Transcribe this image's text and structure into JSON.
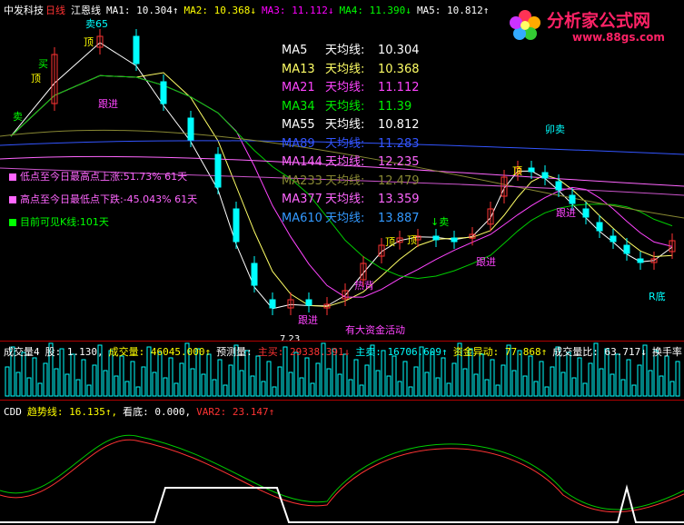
{
  "header": {
    "stock_name": "中发科技",
    "period": "日线",
    "indicator": "江恩线",
    "ma_values": [
      {
        "label": "MA1:",
        "value": "10.304",
        "arrow": "↑",
        "color": "#ffffff"
      },
      {
        "label": "MA2:",
        "value": "10.368",
        "arrow": "↓",
        "color": "#ffff00"
      },
      {
        "label": "MA3:",
        "value": "11.112",
        "arrow": "↓",
        "color": "#ff00ff"
      },
      {
        "label": "MA4:",
        "value": "11.390",
        "arrow": "↓",
        "color": "#00ff00"
      },
      {
        "label": "MA5:",
        "value": "10.812",
        "arrow": "↑",
        "color": "#ffffff"
      }
    ]
  },
  "logo": {
    "text": "分析家公式网",
    "url": "www.88gs.com"
  },
  "ma_table": [
    {
      "name": "MA5",
      "label": "天均线:",
      "value": "10.304",
      "color": "#ffffff"
    },
    {
      "name": "MA13",
      "label": "天均线:",
      "value": "10.368",
      "color": "#ffff66"
    },
    {
      "name": "MA21",
      "label": "天均线:",
      "value": "11.112",
      "color": "#ff44ff"
    },
    {
      "name": "MA34",
      "label": "天均线:",
      "value": "11.39",
      "color": "#00ee00"
    },
    {
      "name": "MA55",
      "label": "天均线:",
      "value": "10.812",
      "color": "#ffffff"
    },
    {
      "name": "MA89",
      "label": "天均线:",
      "value": "11.283",
      "color": "#3355ff"
    },
    {
      "name": "MA144",
      "label": "天均线:",
      "value": "12.235",
      "color": "#ff66ff"
    },
    {
      "name": "MA233",
      "label": "天均线:",
      "value": "12.479",
      "color": "#888833"
    },
    {
      "name": "MA377",
      "label": "天均线:",
      "value": "13.359",
      "color": "#ff66ff"
    },
    {
      "name": "MA610",
      "label": "天均线:",
      "value": "13.887",
      "color": "#3399ff"
    }
  ],
  "stats": [
    {
      "text": "低点至今日最高点上涨:51.73%  61天",
      "color": "#ff66ff"
    },
    {
      "text": "高点至今日最低点下跌:-45.043%  61天",
      "color": "#ff66ff"
    },
    {
      "text": "目前可见K线:101天",
      "color": "#00ff00"
    }
  ],
  "annotations": [
    {
      "text": "卖65",
      "color": "#00ffff"
    },
    {
      "text": "顶",
      "color": "#ffff00"
    },
    {
      "text": "顶",
      "color": "#ffff00"
    },
    {
      "text": "买",
      "color": "#00ff00"
    },
    {
      "text": "卖",
      "color": "#00ff00"
    },
    {
      "text": "跟进",
      "color": "#ff44ff"
    },
    {
      "text": "7.23",
      "color": "#ffffff"
    },
    {
      "text": "跟进",
      "color": "#ff44ff"
    },
    {
      "text": "热背",
      "color": "#ff44ff"
    },
    {
      "text": "有大资金活动",
      "color": "#ff44ff"
    },
    {
      "text": "顶",
      "color": "#ffff00"
    },
    {
      "text": "顶",
      "color": "#ffff00"
    },
    {
      "text": "↓卖",
      "color": "#00ff00"
    },
    {
      "text": "跟进",
      "color": "#ff44ff"
    },
    {
      "text": "顶",
      "color": "#ffff00"
    },
    {
      "text": "卯卖",
      "color": "#00ffff"
    },
    {
      "text": "跟进",
      "color": "#ff44ff"
    },
    {
      "text": "R底",
      "color": "#00ffff"
    }
  ],
  "volume_header": {
    "name": "成交量4",
    "items": [
      {
        "text": "股: 1.130,",
        "color": "#ffffff"
      },
      {
        "text": "成交量: 46045.000↑",
        "color": "#ffff00"
      },
      {
        "text": "预测量:",
        "color": "#ffffff"
      },
      {
        "text": "主买: 29338.391↓",
        "color": "#ff3333"
      },
      {
        "text": "主卖: 16706.609↑",
        "color": "#00ffff"
      },
      {
        "text": "资金异动: 77.868↑",
        "color": "#ffff00"
      },
      {
        "text": "成交量比: 63.717↓",
        "color": "#ffffff"
      },
      {
        "text": "换手率",
        "color": "#ffffff"
      }
    ]
  },
  "cdd_header": {
    "name": "CDD",
    "items": [
      {
        "text": "趋势线: 16.135↑,",
        "color": "#ffff00"
      },
      {
        "text": "看底: 0.000,",
        "color": "#ffffff"
      },
      {
        "text": "VAR2: 23.147↑",
        "color": "#ff3333"
      }
    ]
  },
  "colors": {
    "up": "#ff3333",
    "down": "#00ffff",
    "background": "#000000",
    "separator": "#b00000"
  }
}
